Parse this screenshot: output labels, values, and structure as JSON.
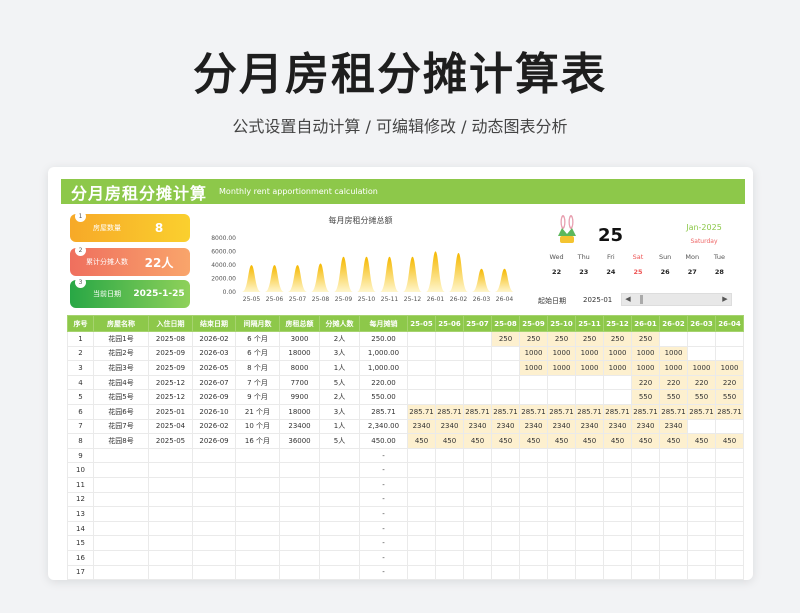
{
  "page": {
    "title": "分月房租分摊计算表",
    "subtitle": "公式设置自动计算 /  可编辑修改  / 动态图表分析"
  },
  "sheet": {
    "title": "分月房租分摊计算",
    "subtitle": "Monthly rent apportionment calculation",
    "accent": "#8dc84a",
    "stats": [
      {
        "badge": "1",
        "label": "房屋数量",
        "value": "8"
      },
      {
        "badge": "2",
        "label": "累计分摊人数",
        "value": "22人"
      },
      {
        "badge": "3",
        "label": "当前日期",
        "value": "2025-1-25"
      }
    ]
  },
  "calendar": {
    "day": "25",
    "month": "Jan-2025",
    "weekday": "Saturday",
    "week_headers": [
      "Wed",
      "Thu",
      "Fri",
      "Sat",
      "Sun",
      "Mon",
      "Tue"
    ],
    "week_days": [
      "22",
      "23",
      "24",
      "25",
      "26",
      "27",
      "28"
    ],
    "start_label": "起始日期",
    "start_value": "2025-01"
  },
  "chart_data": {
    "type": "area",
    "title": "每月房租分摊总额",
    "categories": [
      "25-05",
      "25-06",
      "25-07",
      "25-08",
      "25-09",
      "25-10",
      "25-11",
      "25-12",
      "26-01",
      "26-02",
      "26-03",
      "26-04"
    ],
    "y_ticks": [
      "0.00",
      "2000.00",
      "4000.00",
      "6000.00",
      "8000.00"
    ],
    "ylim": [
      0,
      8000
    ],
    "values": [
      3975.71,
      3975.71,
      3975.71,
      4225.71,
      5225.71,
      5225.71,
      5225.71,
      5225.71,
      6025.71,
      5775.71,
      3435.71,
      3435.71
    ],
    "colors": [
      "#f5b800",
      "#fff6cc"
    ]
  },
  "table": {
    "headers": [
      "序号",
      "房屋名称",
      "入住日期",
      "结束日期",
      "间隔月数",
      "房租总额",
      "分摊人数",
      "每月摊销",
      "25-05",
      "25-06",
      "25-07",
      "25-08",
      "25-09",
      "25-10",
      "25-11",
      "25-12",
      "26-01",
      "26-02",
      "26-03",
      "26-04"
    ],
    "rows": [
      {
        "cells": [
          "1",
          "花园1号",
          "2025-08",
          "2026-02",
          "6 个月",
          "3000",
          "2人",
          "250.00",
          "",
          "",
          "",
          "250",
          "250",
          "250",
          "250",
          "250",
          "250",
          "",
          "",
          ""
        ]
      },
      {
        "cells": [
          "2",
          "花园2号",
          "2025-09",
          "2026-03",
          "6 个月",
          "18000",
          "3人",
          "1,000.00",
          "",
          "",
          "",
          "",
          "1000",
          "1000",
          "1000",
          "1000",
          "1000",
          "1000",
          "",
          ""
        ]
      },
      {
        "cells": [
          "3",
          "花园3号",
          "2025-09",
          "2026-05",
          "8 个月",
          "8000",
          "1人",
          "1,000.00",
          "",
          "",
          "",
          "",
          "1000",
          "1000",
          "1000",
          "1000",
          "1000",
          "1000",
          "1000",
          "1000"
        ]
      },
      {
        "cells": [
          "4",
          "花园4号",
          "2025-12",
          "2026-07",
          "7 个月",
          "7700",
          "5人",
          "220.00",
          "",
          "",
          "",
          "",
          "",
          "",
          "",
          "",
          "220",
          "220",
          "220",
          "220"
        ]
      },
      {
        "cells": [
          "5",
          "花园5号",
          "2025-12",
          "2026-09",
          "9 个月",
          "9900",
          "2人",
          "550.00",
          "",
          "",
          "",
          "",
          "",
          "",
          "",
          "",
          "550",
          "550",
          "550",
          "550"
        ]
      },
      {
        "cells": [
          "6",
          "花园6号",
          "2025-01",
          "2026-10",
          "21 个月",
          "18000",
          "3人",
          "285.71",
          "285.71",
          "285.71",
          "285.71",
          "285.71",
          "285.71",
          "285.71",
          "285.71",
          "285.71",
          "285.71",
          "285.71",
          "285.71",
          "285.71"
        ]
      },
      {
        "cells": [
          "7",
          "花园7号",
          "2025-04",
          "2026-02",
          "10 个月",
          "23400",
          "1人",
          "2,340.00",
          "2340",
          "2340",
          "2340",
          "2340",
          "2340",
          "2340",
          "2340",
          "2340",
          "2340",
          "2340",
          "",
          ""
        ]
      },
      {
        "cells": [
          "8",
          "花园8号",
          "2025-05",
          "2026-09",
          "16 个月",
          "36000",
          "5人",
          "450.00",
          "450",
          "450",
          "450",
          "450",
          "450",
          "450",
          "450",
          "450",
          "450",
          "450",
          "450",
          "450"
        ]
      },
      {
        "cells": [
          "9",
          "",
          "",
          "",
          "",
          "",
          "",
          "-",
          "",
          "",
          "",
          "",
          "",
          "",
          "",
          "",
          "",
          "",
          "",
          ""
        ]
      },
      {
        "cells": [
          "10",
          "",
          "",
          "",
          "",
          "",
          "",
          "-",
          "",
          "",
          "",
          "",
          "",
          "",
          "",
          "",
          "",
          "",
          "",
          ""
        ]
      },
      {
        "cells": [
          "11",
          "",
          "",
          "",
          "",
          "",
          "",
          "-",
          "",
          "",
          "",
          "",
          "",
          "",
          "",
          "",
          "",
          "",
          "",
          ""
        ]
      },
      {
        "cells": [
          "12",
          "",
          "",
          "",
          "",
          "",
          "",
          "-",
          "",
          "",
          "",
          "",
          "",
          "",
          "",
          "",
          "",
          "",
          "",
          ""
        ]
      },
      {
        "cells": [
          "13",
          "",
          "",
          "",
          "",
          "",
          "",
          "-",
          "",
          "",
          "",
          "",
          "",
          "",
          "",
          "",
          "",
          "",
          "",
          ""
        ]
      },
      {
        "cells": [
          "14",
          "",
          "",
          "",
          "",
          "",
          "",
          "-",
          "",
          "",
          "",
          "",
          "",
          "",
          "",
          "",
          "",
          "",
          "",
          ""
        ]
      },
      {
        "cells": [
          "15",
          "",
          "",
          "",
          "",
          "",
          "",
          "-",
          "",
          "",
          "",
          "",
          "",
          "",
          "",
          "",
          "",
          "",
          "",
          ""
        ]
      },
      {
        "cells": [
          "16",
          "",
          "",
          "",
          "",
          "",
          "",
          "-",
          "",
          "",
          "",
          "",
          "",
          "",
          "",
          "",
          "",
          "",
          "",
          ""
        ]
      },
      {
        "cells": [
          "17",
          "",
          "",
          "",
          "",
          "",
          "",
          "-",
          "",
          "",
          "",
          "",
          "",
          "",
          "",
          "",
          "",
          "",
          "",
          ""
        ]
      }
    ]
  }
}
